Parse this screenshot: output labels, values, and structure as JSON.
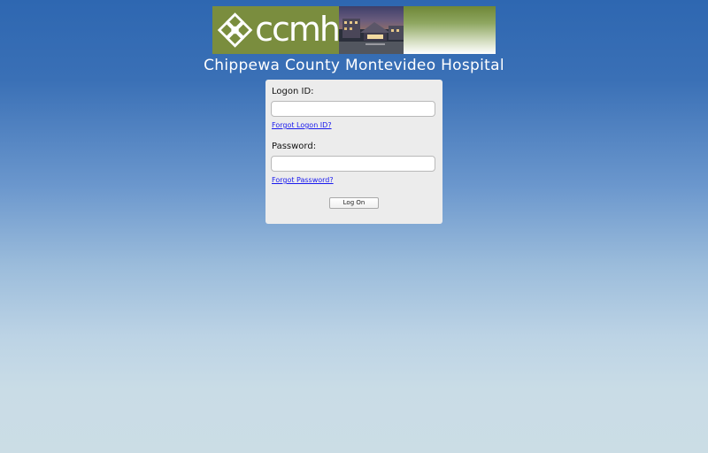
{
  "header": {
    "logo_text": "ccmh",
    "hospital_name": "Chippewa County Montevideo Hospital"
  },
  "login": {
    "logon_id_label": "Logon ID:",
    "logon_id_value": "",
    "forgot_logon_id": "Forgot Logon ID?",
    "password_label": "Password:",
    "password_value": "",
    "forgot_password": "Forgot Password?",
    "submit_label": "Log On"
  },
  "colors": {
    "brand_green": "#7a8d3e",
    "link_blue": "#1a1aee",
    "background_top": "#2e67b1",
    "background_bottom": "#cbdde5"
  }
}
